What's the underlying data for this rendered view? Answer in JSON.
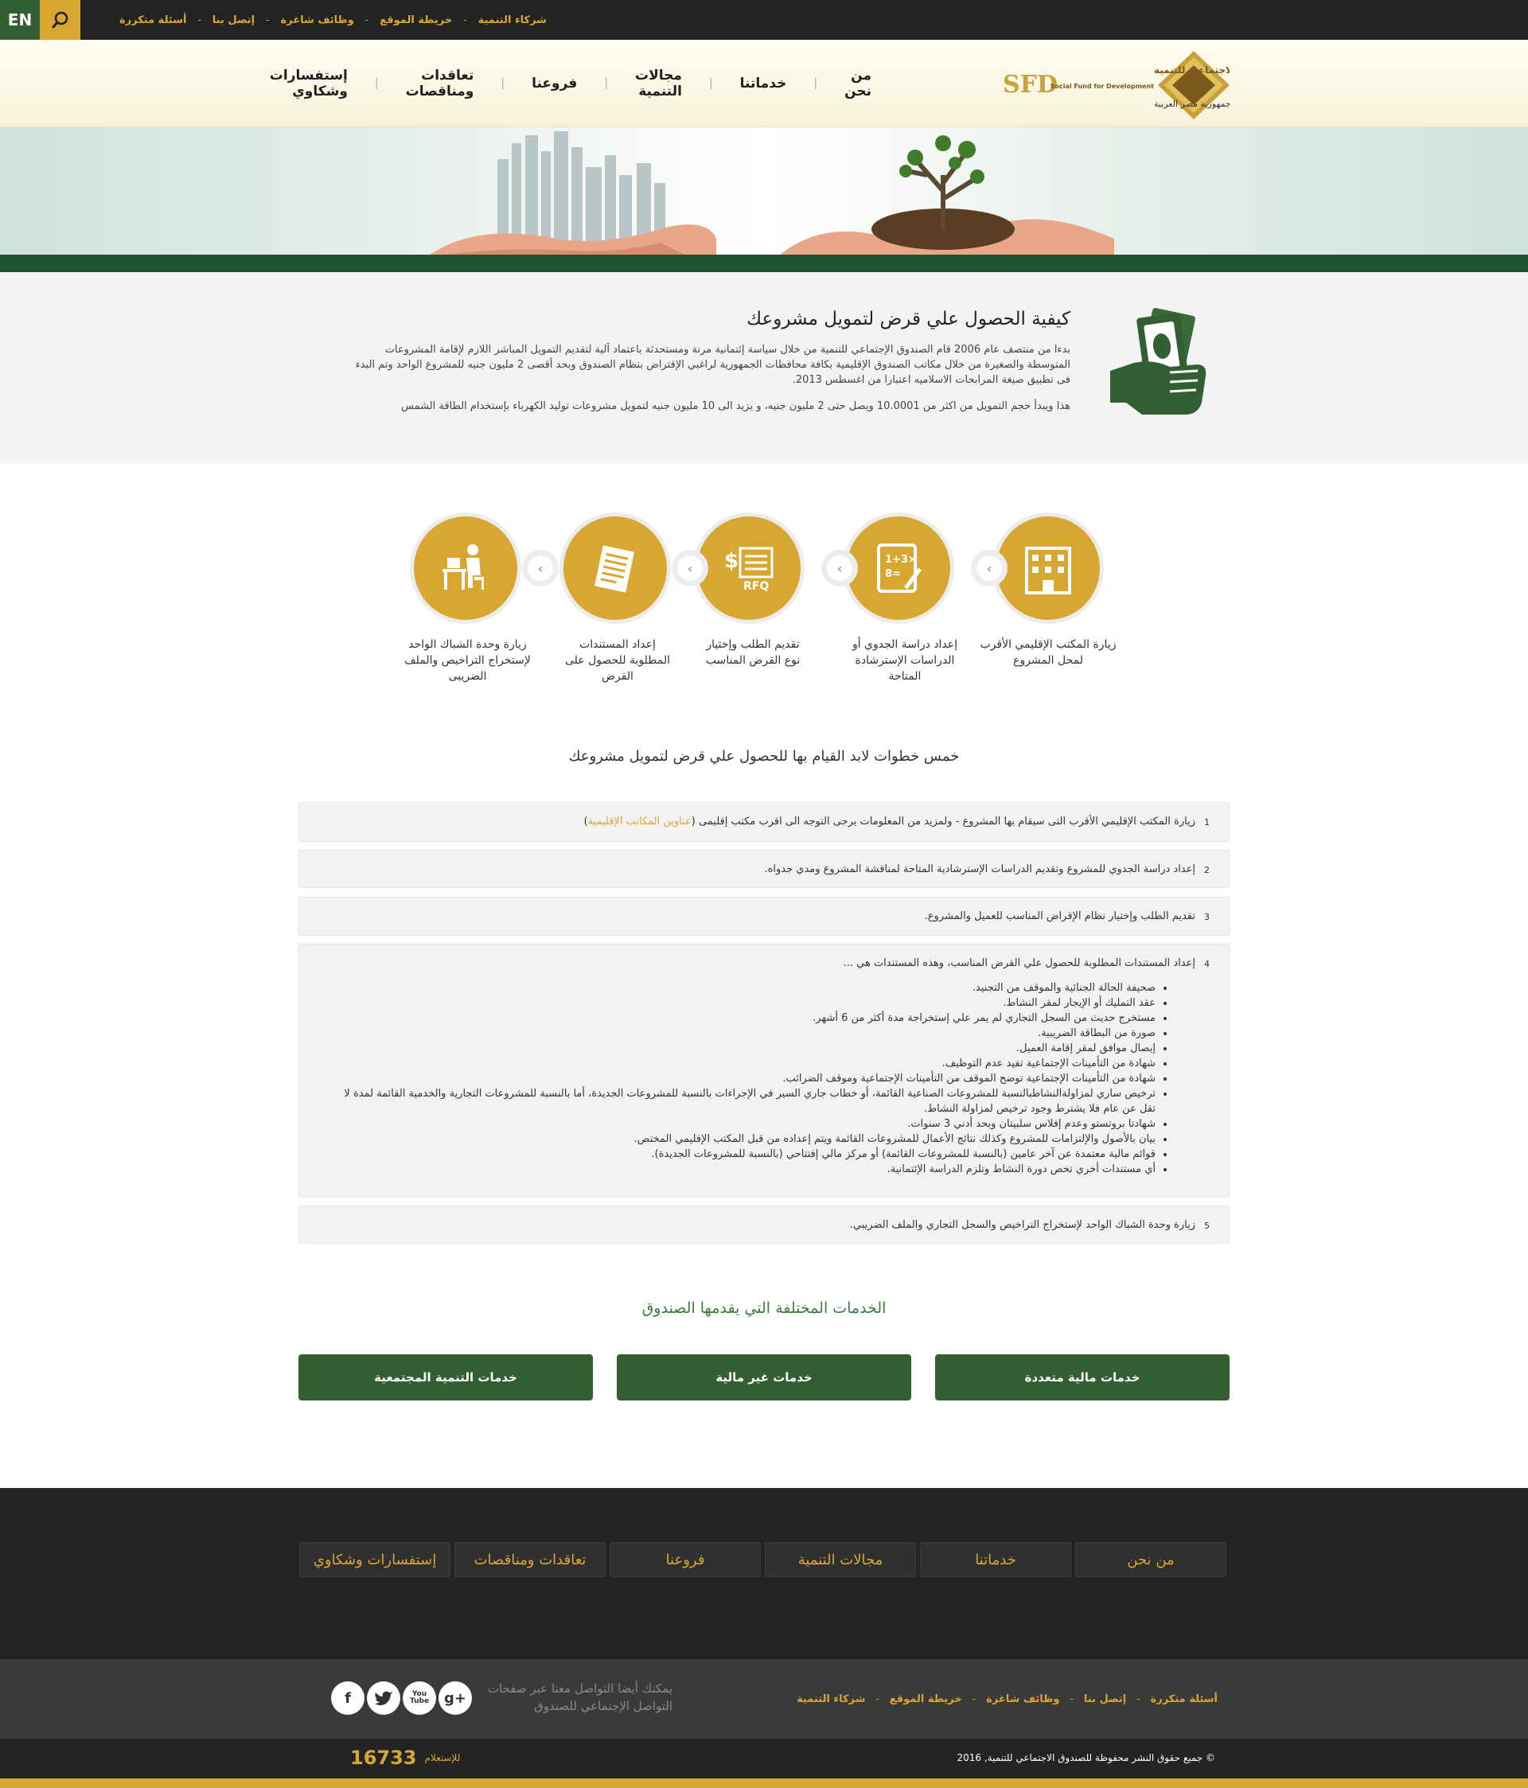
{
  "topbar": {
    "lang": "EN",
    "links": [
      "أسئلة متكررة",
      "إتصل بنا",
      "وظائف شاغرة",
      "خريطة الموقع",
      "شركاء التنمية"
    ]
  },
  "header": {
    "logo_ar": "الصندوق الاجتماعي للتنمية",
    "logo_en": "Social Fund for Development",
    "logo_abbr": "SFD",
    "logo_country": "جمهورية مصر العربية",
    "nav": [
      "من نحن",
      "خدماتنا",
      "مجالات التنمية",
      "فروعنا",
      "تعاقدات ومناقصات",
      "إستفسارات وشكاوي"
    ]
  },
  "intro": {
    "title": "كيفية الحصول علي قرض لتمويل مشروعك",
    "p1": "بدءا من منتصف عام 2006 قام الصندوق الإجتماعي للتنمية من خلال سياسة إئتمانية مرنة ومستحدثة باعتماد آلية لتقديم التمويل المباشر اللازم لإقامة المشروعات المتوسطة والصغيرة من خلال مكاتب الصندوق الإقليمية بكافة محافظات الجمهورية لراغبي الإقتراض بنظام الصندوق وبحد أقصى 2 مليون جنيه للمشروع الواحد وتم البدء فى تطبيق صيغة المرابحات الاسلاميه اعتبارا من اغسطس 2013.",
    "p2": "هذا ويبدأ حجم التمويل من اكثر من 10.0001 ويصل حتى 2 مليون جنيه، و يزيد الى 10 مليون جنيه لتمويل مشروعات توليد الكهرباء بإستخدام الطاقة الشمس"
  },
  "steps": [
    {
      "label": "زيارة المكتب الإقليمي الأقرب لمحل المشروع"
    },
    {
      "label": "إعداد دراسة الجدوي أو الدراسات الإسترشادة المتاحة"
    },
    {
      "label": "تقديم الطلب وإختيار نوع القرض المناسب"
    },
    {
      "label": "إعداد المستندات المطلوبة للحصول على القرض"
    },
    {
      "label": "زيارة وحدة الشباك الواحد لإستخراج التراخيص والملف الضريبى"
    }
  ],
  "five_steps_title": "خمس خطوات لابد القيام بها للحصول علي قرض لتمويل مشروعك",
  "accordion": [
    {
      "num": "1",
      "text": "زيارة المكتب الإقليمي الأقرب التى سيقام بها المشروع - ولمزيد من المعلومات يرجى التوجه الى اقرب مكتب إقليمى (",
      "link": "عناوين المكاتب الإقليمية",
      "tail": ")"
    },
    {
      "num": "2",
      "text": "إعداد دراسة الجدوي للمشروع وتقديم الدراسات الإسترشادية المتاحة لمناقشة المشروع ومدي جدواه."
    },
    {
      "num": "3",
      "text": "تقديم الطلب وإختيار نظام الإقراض المناسب للعميل والمشروع."
    },
    {
      "num": "4",
      "text": "إعداد المستندات المطلوبة للحصول علي القرض المناسب، وهذه المستندات هي ...",
      "items": [
        "صحيفة الحالة الجنائية والموقف من التجنيد.",
        "عقد التمليك أو الإيجار لمقر النشاط.",
        "مستخرج حديث من السجل التجاري لم يمر علي إستخراجة مدة أكثر من 6 أشهر.",
        "صورة من البطاقة الضريبية.",
        "إيصال موافق لمقر إقامة العميل.",
        "شهادة من التأمينات الإجتماعية تفيد عدم التوظيف.",
        "شهادة من التأمينات الإجتماعية توضح الموقف من التأمينات الإجتماعية وموقف الضرائب.",
        "ترخيص ساري لمزاولةالنشاطبالنسبة للمشروعات الصناعية القائمة، أو خطاب جاري السير في الإجراءات بالنسبة للمشروعات الجديدة، أما بالنسبة للمشروعات التجارية والخدمية القائمة لمدة لا تقل عن عام فلا يشترط وجود ترخيص لمزاولة النشاط.",
        "شهادتا بروتستو وعدم إفلاس سلبيتان وبحد أدني 3 سنوات.",
        "بيان بالأصول والإلتزامات للمشروع وكذلك نتائج الأعمال للمشروعات القائمة ويتم إعداده من قبل المكتب الإقليمي المختص.",
        "قوائم مالية معتمدة عن آخر عامين (بالنسبة للمشروعات القائمة) أو مركز مالي إفتتاحي (بالنسبة للمشروعات الجديدة).",
        "أي مستندات أخري تخص دورة النشاط وتلزم الدراسة الإئتمانية."
      ]
    },
    {
      "num": "5",
      "text": "زيارة وحدة الشباك الواحد لإستخراج التراخيص والسجل التجاري والملف الضريبي."
    }
  ],
  "services": {
    "title": "الخدمات المختلفة التي يقدمها الصندوق",
    "buttons": [
      "خدمات مالية متعددة",
      "خدمات غير مالية",
      "خدمات التنمية المجتمعية"
    ]
  },
  "footer": {
    "nav": [
      "من نحن",
      "خدماتنا",
      "مجالات التنمية",
      "فروعنا",
      "تعاقدات ومناقصات",
      "إستفسارات وشكاوي"
    ],
    "links": [
      "أسئلة متكررة",
      "إتصل بنا",
      "وظائف شاغرة",
      "خريطة الموقع",
      "شركاء التنمية"
    ],
    "social_text": "يمكنك أيضا التواصل معنا عبر صفحات التواصل الإجتماعي للصندوق",
    "social": [
      "g+",
      "You Tube",
      "twitter",
      "f"
    ],
    "copyright": "© جميع حقوق النشر محفوظة للصندوق الاجتماعي للتنمية, 2016",
    "hotline_label": "للإستعلام",
    "hotline_number": "16733"
  },
  "colors": {
    "gold": "#d8a732",
    "green": "#326033",
    "dark": "#232323"
  }
}
